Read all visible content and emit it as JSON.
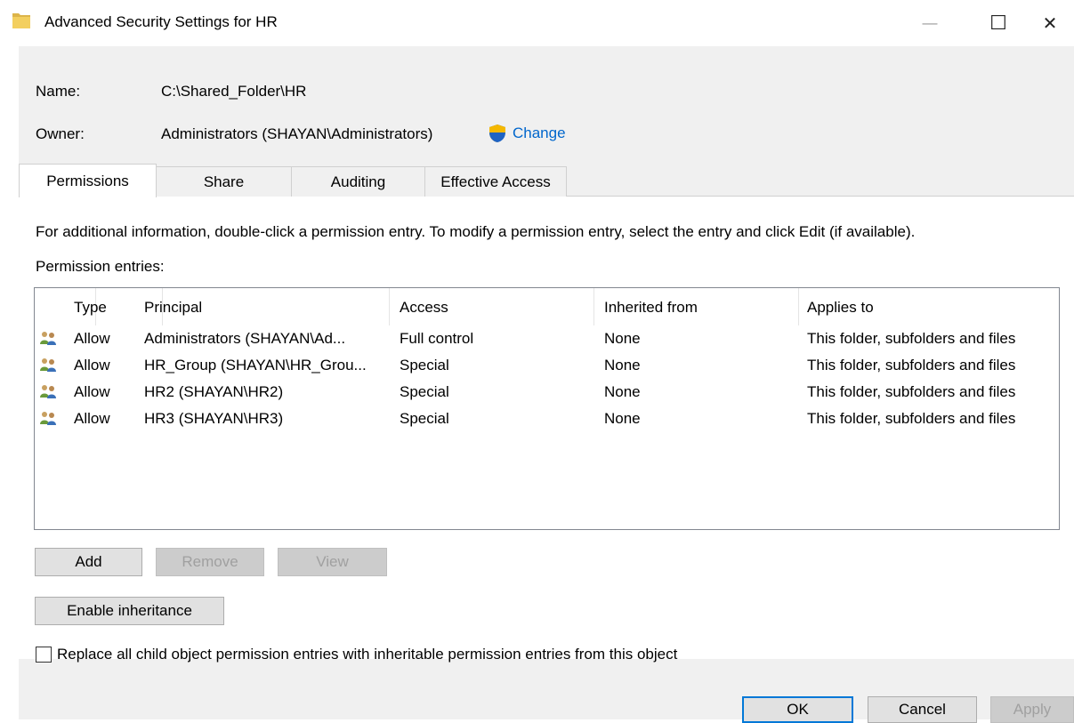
{
  "window": {
    "title": "Advanced Security Settings for HR",
    "icon": "folder-icon",
    "controls": {
      "minimize": "—",
      "maximize": "☐",
      "close": "✕"
    }
  },
  "info": {
    "name_label": "Name:",
    "name_value": "C:\\Shared_Folder\\HR",
    "owner_label": "Owner:",
    "owner_value": "Administrators (SHAYAN\\Administrators)",
    "change_label": "Change",
    "change_icon": "uac-shield-icon"
  },
  "tabs": [
    {
      "label": "Permissions",
      "active": true
    },
    {
      "label": "Share",
      "active": false
    },
    {
      "label": "Auditing",
      "active": false
    },
    {
      "label": "Effective Access",
      "active": false
    }
  ],
  "description": "For additional information, double-click a permission entry. To modify a permission entry, select the entry and click Edit (if available).",
  "entries_label": "Permission entries:",
  "table": {
    "columns": [
      "Type",
      "Principal",
      "Access",
      "Inherited from",
      "Applies to"
    ],
    "rows": [
      {
        "icon": "user-group-icon",
        "type": "Allow",
        "principal": "Administrators (SHAYAN\\Ad...",
        "access": "Full control",
        "inherited": "None",
        "applies": "This folder, subfolders and files"
      },
      {
        "icon": "user-group-icon",
        "type": "Allow",
        "principal": "HR_Group (SHAYAN\\HR_Grou...",
        "access": "Special",
        "inherited": "None",
        "applies": "This folder, subfolders and files"
      },
      {
        "icon": "user-group-icon",
        "type": "Allow",
        "principal": "HR2 (SHAYAN\\HR2)",
        "access": "Special",
        "inherited": "None",
        "applies": "This folder, subfolders and files"
      },
      {
        "icon": "user-group-icon",
        "type": "Allow",
        "principal": "HR3 (SHAYAN\\HR3)",
        "access": "Special",
        "inherited": "None",
        "applies": "This folder, subfolders and files"
      }
    ]
  },
  "buttons": {
    "add": "Add",
    "remove": "Remove",
    "view": "View",
    "enable_inheritance": "Enable inheritance",
    "ok": "OK",
    "cancel": "Cancel",
    "apply": "Apply"
  },
  "replace_checkbox": {
    "label": "Replace all child object permission entries with inheritable permission entries from this object",
    "checked": false
  },
  "colors": {
    "link": "#0066cc",
    "dialog_bg": "#f0f0f0",
    "default_button_border": "#0078d7"
  }
}
